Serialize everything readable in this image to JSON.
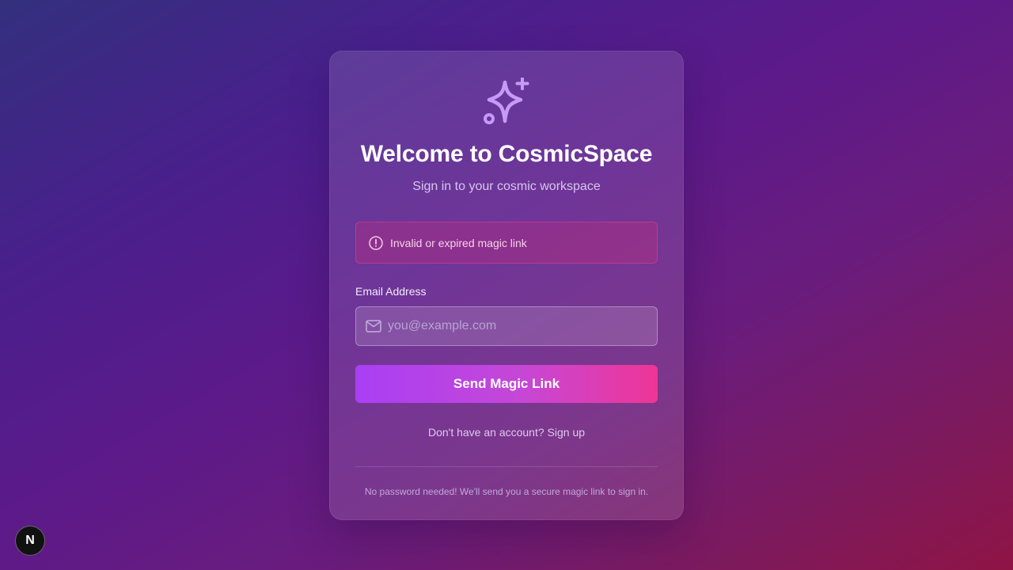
{
  "brand": {
    "logo_icon": "sparkle-icon",
    "title": "Welcome to CosmicSpace",
    "subtitle": "Sign in to your cosmic workspace"
  },
  "alert": {
    "icon": "alert-circle-icon",
    "message": "Invalid or expired magic link"
  },
  "form": {
    "email_label": "Email Address",
    "email_icon": "mail-icon",
    "email_value": "",
    "email_placeholder": "you@example.com",
    "submit_label": "Send Magic Link"
  },
  "signup": {
    "prompt": "Don't have an account? ",
    "link_label": "Sign up"
  },
  "footer": {
    "note": "No password needed! We'll send you a secure magic link to sign in."
  },
  "dev_badge": {
    "label": "N"
  },
  "colors": {
    "accent_purple": "#a93ff5",
    "accent_pink": "#ef3596",
    "logo": "#c89af8",
    "alert_border": "#ec4899"
  }
}
